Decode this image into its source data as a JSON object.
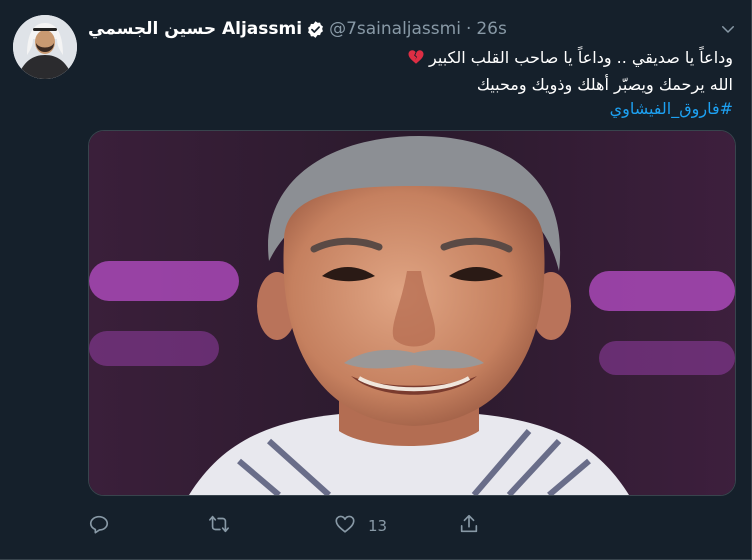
{
  "tweet": {
    "display_name": "حسين الجسمي Aljassmi",
    "handle": "@7sainaljassmi",
    "separator": "·",
    "time": "26s",
    "text_lines": [
      "وداعاً يا صديقي .. وداعاً يا صاحب القلب الكبير",
      "الله يرحمك ويصبّر أهلك وذويك ومحبيك"
    ],
    "hashtag": "#فاروق_الفيشاوي",
    "like_count": "13"
  },
  "icons": {
    "verified": "verified-badge-icon",
    "caret": "chevron-down-icon",
    "broken_heart": "broken-heart-emoji",
    "reply": "reply-icon",
    "retweet": "retweet-icon",
    "like": "heart-icon",
    "share": "share-icon"
  },
  "colors": {
    "background": "#15202b",
    "text": "#ffffff",
    "muted": "#8899a6",
    "link": "#1da1f2",
    "border": "#38444d"
  }
}
